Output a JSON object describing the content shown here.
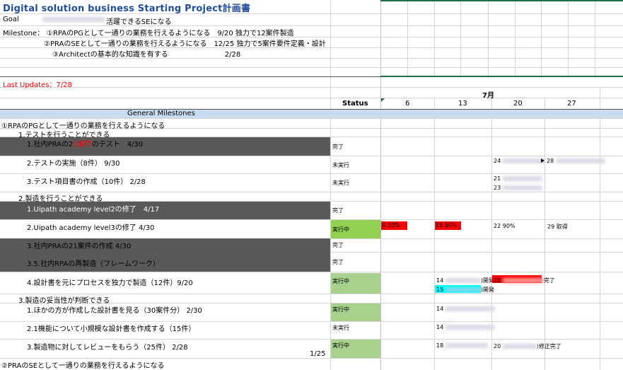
{
  "header": {
    "title": "Digital solution business Starting Project計画書",
    "goal_label": "Goal",
    "goal_text": "活躍できるSEになる",
    "milestone_label": "Milestone：",
    "milestones": [
      "①RPAのPGとして一通りの業務を行えるようになる　9/20 独力で12案件製造",
      "②PRAのSEとして一通りの業務を行えるようになる　12/25 独力で5案件要件定義・設計",
      "③Architectの基本的な知識を有する　　　　　　　　2/28"
    ],
    "last_updates": "Last Updates：7/28"
  },
  "colors": {
    "title": "#1f4e9a",
    "red_text": "#ff0000",
    "section_band": "#c9dcef",
    "dark_row": "#595959",
    "status_green": "#92d050",
    "status_light_green": "#a9d18e",
    "red_bar": "#ff0000",
    "cyan_bar": "#00ffff",
    "green_line": "#1e7145"
  },
  "table": {
    "month": "7月",
    "status_header": "Status",
    "week_columns": [
      "6",
      "13",
      "20",
      "27"
    ],
    "section_title": "General Milestones"
  },
  "rows": {
    "m1": "①RPAのPGとして一通りの業務を行えるようになる",
    "g1": "1.テストを行うことができる",
    "r1": "1.社内PRAの2",
    "r1_red": "1案件",
    "r1_tail": "のテスト　4/30",
    "r1_status": "完了",
    "r2": "2.テストの実施（8件）  9/30",
    "r2_status": "未実行",
    "r3": "3.テスト項目書の作成（10件）  2/28",
    "r3_status": "未実行",
    "g2": "2.製造を行うことができる",
    "r4": "1.Uipath academy level2の修了　4/17",
    "r4_status": "完了",
    "r5": "2.Uipath academy level3の修了  4/30",
    "r5_status": "実行中",
    "r6": "3.社内PRAの21案件の作成  4/30",
    "r6_status": "完了",
    "r7": "3.5.社内RPAの再製造（フレームワーク）",
    "r7_status": "完了",
    "r8": "4.設計書を元にプロセスを独力で製造（12件）9/20",
    "r8_status": "実行中",
    "g3": "3.製造の妥当性が判断できる",
    "r9": "1.ほかの方が作成した設計書を見る（30案件分）  2/30",
    "r9_status": "実行中",
    "r10": "2.1機能について小規模な設計書を作成する（15件）",
    "r10_status": "未実行",
    "r11": "3.製造物に対してレビューをもらう（25件）  2/28",
    "r11_status": "実行中",
    "page_num": "1/25",
    "m2": "②PRAのSEとして一通りの業務を行えるようになる"
  },
  "gantt": {
    "r2_a": "24",
    "r2_b": "28",
    "r3_a": "21",
    "r3_b": "23",
    "r5_bar1": "8 30%",
    "r5_bar2": "15 60%",
    "r5_c3": "22 90%",
    "r5_c4": "29 取得",
    "r8_a": "14",
    "r8_a_tail": ")開発",
    "r8_b": "20",
    "r8_b_tail": "完了",
    "r8_c": "15",
    "r8_c_tail": ")開発",
    "r9_a": "14",
    "r10_a": "14",
    "r11_a": "18",
    "r11_b": "20",
    "r11_b_tail": ")修正完了"
  }
}
